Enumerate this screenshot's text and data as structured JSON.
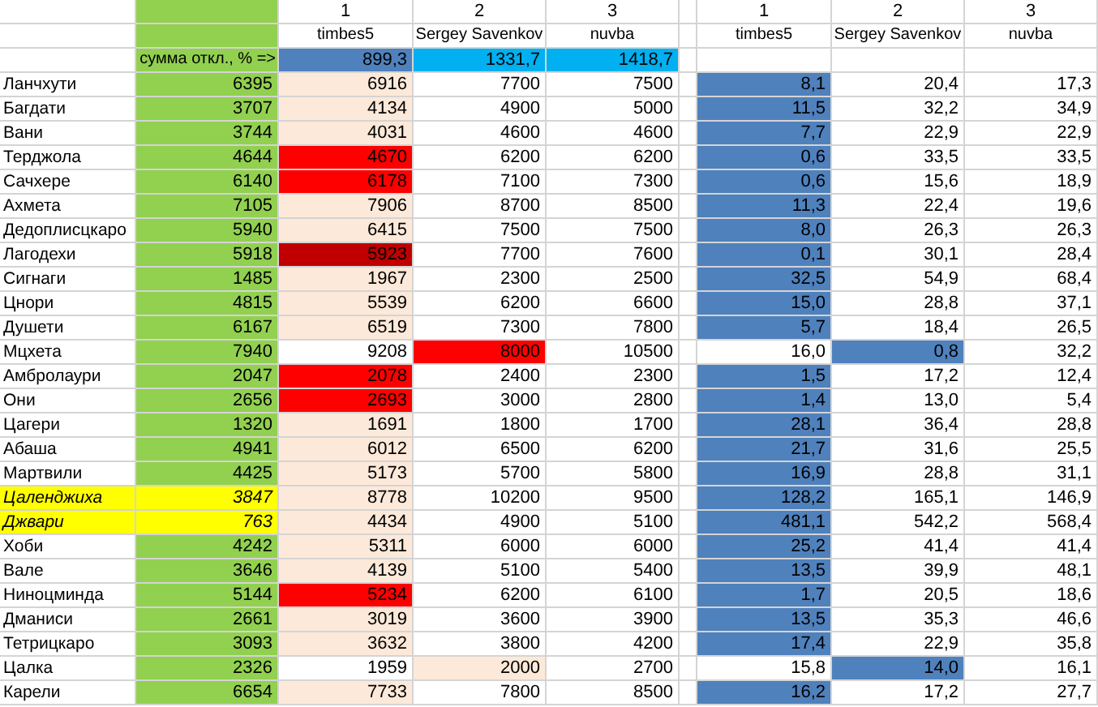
{
  "column_numbers": [
    "1",
    "2",
    "3"
  ],
  "participants": [
    "timbes5",
    "Sergey Savenkov",
    "nuvba"
  ],
  "totals_label": "сумма откл., % =>",
  "totals": [
    {
      "value": "899,3",
      "best": true
    },
    {
      "value": "1331,7",
      "best": false
    },
    {
      "value": "1418,7",
      "best": false
    }
  ],
  "deviation_column_numbers": [
    "1",
    "2",
    "3"
  ],
  "deviation_participants": [
    "timbes5",
    "Sergey Savenkov",
    "nuvba"
  ],
  "rows": [
    {
      "name": "Ланчхути",
      "actual": "6395",
      "emphasized": false,
      "estimates": [
        {
          "value": "6916",
          "color": "#fde9d9"
        },
        {
          "value": "7700",
          "color": "#ffffff"
        },
        {
          "value": "7500",
          "color": "#ffffff"
        }
      ],
      "deviations": [
        {
          "value": "8,1",
          "best": true
        },
        {
          "value": "20,4",
          "best": false
        },
        {
          "value": "17,3",
          "best": false
        }
      ]
    },
    {
      "name": "Багдати",
      "actual": "3707",
      "emphasized": false,
      "estimates": [
        {
          "value": "4134",
          "color": "#fde9d9"
        },
        {
          "value": "4900",
          "color": "#ffffff"
        },
        {
          "value": "5000",
          "color": "#ffffff"
        }
      ],
      "deviations": [
        {
          "value": "11,5",
          "best": true
        },
        {
          "value": "32,2",
          "best": false
        },
        {
          "value": "34,9",
          "best": false
        }
      ]
    },
    {
      "name": "Вани",
      "actual": "3744",
      "emphasized": false,
      "estimates": [
        {
          "value": "4031",
          "color": "#fde9d9"
        },
        {
          "value": "4600",
          "color": "#ffffff"
        },
        {
          "value": "4600",
          "color": "#ffffff"
        }
      ],
      "deviations": [
        {
          "value": "7,7",
          "best": true
        },
        {
          "value": "22,9",
          "best": false
        },
        {
          "value": "22,9",
          "best": false
        }
      ]
    },
    {
      "name": "Терджола",
      "actual": "4644",
      "emphasized": false,
      "estimates": [
        {
          "value": "4670",
          "color": "#ff0000"
        },
        {
          "value": "6200",
          "color": "#ffffff"
        },
        {
          "value": "6200",
          "color": "#ffffff"
        }
      ],
      "deviations": [
        {
          "value": "0,6",
          "best": true
        },
        {
          "value": "33,5",
          "best": false
        },
        {
          "value": "33,5",
          "best": false
        }
      ]
    },
    {
      "name": "Сачхере",
      "actual": "6140",
      "emphasized": false,
      "estimates": [
        {
          "value": "6178",
          "color": "#ff0000"
        },
        {
          "value": "7100",
          "color": "#ffffff"
        },
        {
          "value": "7300",
          "color": "#ffffff"
        }
      ],
      "deviations": [
        {
          "value": "0,6",
          "best": true
        },
        {
          "value": "15,6",
          "best": false
        },
        {
          "value": "18,9",
          "best": false
        }
      ]
    },
    {
      "name": "Ахмета",
      "actual": "7105",
      "emphasized": false,
      "estimates": [
        {
          "value": "7906",
          "color": "#fde9d9"
        },
        {
          "value": "8700",
          "color": "#ffffff"
        },
        {
          "value": "8500",
          "color": "#ffffff"
        }
      ],
      "deviations": [
        {
          "value": "11,3",
          "best": true
        },
        {
          "value": "22,4",
          "best": false
        },
        {
          "value": "19,6",
          "best": false
        }
      ]
    },
    {
      "name": "Дедоплисцкаро",
      "actual": "5940",
      "emphasized": false,
      "estimates": [
        {
          "value": "6415",
          "color": "#fde9d9"
        },
        {
          "value": "7500",
          "color": "#ffffff"
        },
        {
          "value": "7500",
          "color": "#ffffff"
        }
      ],
      "deviations": [
        {
          "value": "8,0",
          "best": true
        },
        {
          "value": "26,3",
          "best": false
        },
        {
          "value": "26,3",
          "best": false
        }
      ]
    },
    {
      "name": "Лагодехи",
      "actual": "5918",
      "emphasized": false,
      "estimates": [
        {
          "value": "5923",
          "color": "#c00000"
        },
        {
          "value": "7700",
          "color": "#ffffff"
        },
        {
          "value": "7600",
          "color": "#ffffff"
        }
      ],
      "deviations": [
        {
          "value": "0,1",
          "best": true
        },
        {
          "value": "30,1",
          "best": false
        },
        {
          "value": "28,4",
          "best": false
        }
      ]
    },
    {
      "name": "Сигнаги",
      "actual": "1485",
      "emphasized": false,
      "estimates": [
        {
          "value": "1967",
          "color": "#fde9d9"
        },
        {
          "value": "2300",
          "color": "#ffffff"
        },
        {
          "value": "2500",
          "color": "#ffffff"
        }
      ],
      "deviations": [
        {
          "value": "32,5",
          "best": true
        },
        {
          "value": "54,9",
          "best": false
        },
        {
          "value": "68,4",
          "best": false
        }
      ]
    },
    {
      "name": "Цнори",
      "actual": "4815",
      "emphasized": false,
      "estimates": [
        {
          "value": "5539",
          "color": "#fde9d9"
        },
        {
          "value": "6200",
          "color": "#ffffff"
        },
        {
          "value": "6600",
          "color": "#ffffff"
        }
      ],
      "deviations": [
        {
          "value": "15,0",
          "best": true
        },
        {
          "value": "28,8",
          "best": false
        },
        {
          "value": "37,1",
          "best": false
        }
      ]
    },
    {
      "name": "Душети",
      "actual": "6167",
      "emphasized": false,
      "estimates": [
        {
          "value": "6519",
          "color": "#fde9d9"
        },
        {
          "value": "7300",
          "color": "#ffffff"
        },
        {
          "value": "7800",
          "color": "#ffffff"
        }
      ],
      "deviations": [
        {
          "value": "5,7",
          "best": true
        },
        {
          "value": "18,4",
          "best": false
        },
        {
          "value": "26,5",
          "best": false
        }
      ]
    },
    {
      "name": "Мцхета",
      "actual": "7940",
      "emphasized": false,
      "estimates": [
        {
          "value": "9208",
          "color": "#ffffff"
        },
        {
          "value": "8000",
          "color": "#ff0000"
        },
        {
          "value": "10500",
          "color": "#ffffff"
        }
      ],
      "deviations": [
        {
          "value": "16,0",
          "best": false
        },
        {
          "value": "0,8",
          "best": true
        },
        {
          "value": "32,2",
          "best": false
        }
      ]
    },
    {
      "name": "Амбролаури",
      "actual": "2047",
      "emphasized": false,
      "estimates": [
        {
          "value": "2078",
          "color": "#ff0000"
        },
        {
          "value": "2400",
          "color": "#ffffff"
        },
        {
          "value": "2300",
          "color": "#ffffff"
        }
      ],
      "deviations": [
        {
          "value": "1,5",
          "best": true
        },
        {
          "value": "17,2",
          "best": false
        },
        {
          "value": "12,4",
          "best": false
        }
      ]
    },
    {
      "name": "Они",
      "actual": "2656",
      "emphasized": false,
      "estimates": [
        {
          "value": "2693",
          "color": "#ff0000"
        },
        {
          "value": "3000",
          "color": "#ffffff"
        },
        {
          "value": "2800",
          "color": "#ffffff"
        }
      ],
      "deviations": [
        {
          "value": "1,4",
          "best": true
        },
        {
          "value": "13,0",
          "best": false
        },
        {
          "value": "5,4",
          "best": false
        }
      ]
    },
    {
      "name": "Цагери",
      "actual": "1320",
      "emphasized": false,
      "estimates": [
        {
          "value": "1691",
          "color": "#fde9d9"
        },
        {
          "value": "1800",
          "color": "#ffffff"
        },
        {
          "value": "1700",
          "color": "#ffffff"
        }
      ],
      "deviations": [
        {
          "value": "28,1",
          "best": true
        },
        {
          "value": "36,4",
          "best": false
        },
        {
          "value": "28,8",
          "best": false
        }
      ]
    },
    {
      "name": "Абаша",
      "actual": "4941",
      "emphasized": false,
      "estimates": [
        {
          "value": "6012",
          "color": "#fde9d9"
        },
        {
          "value": "6500",
          "color": "#ffffff"
        },
        {
          "value": "6200",
          "color": "#ffffff"
        }
      ],
      "deviations": [
        {
          "value": "21,7",
          "best": true
        },
        {
          "value": "31,6",
          "best": false
        },
        {
          "value": "25,5",
          "best": false
        }
      ]
    },
    {
      "name": "Мартвили",
      "actual": "4425",
      "emphasized": false,
      "estimates": [
        {
          "value": "5173",
          "color": "#fde9d9"
        },
        {
          "value": "5700",
          "color": "#ffffff"
        },
        {
          "value": "5800",
          "color": "#ffffff"
        }
      ],
      "deviations": [
        {
          "value": "16,9",
          "best": true
        },
        {
          "value": "28,8",
          "best": false
        },
        {
          "value": "31,1",
          "best": false
        }
      ]
    },
    {
      "name": "Цаленджиха",
      "actual": "3847",
      "emphasized": true,
      "estimates": [
        {
          "value": "8778",
          "color": "#fde9d9"
        },
        {
          "value": "10200",
          "color": "#ffffff"
        },
        {
          "value": "9500",
          "color": "#ffffff"
        }
      ],
      "deviations": [
        {
          "value": "128,2",
          "best": true
        },
        {
          "value": "165,1",
          "best": false
        },
        {
          "value": "146,9",
          "best": false
        }
      ]
    },
    {
      "name": "Джвари",
      "actual": "763",
      "emphasized": true,
      "estimates": [
        {
          "value": "4434",
          "color": "#fde9d9"
        },
        {
          "value": "4900",
          "color": "#ffffff"
        },
        {
          "value": "5100",
          "color": "#ffffff"
        }
      ],
      "deviations": [
        {
          "value": "481,1",
          "best": true
        },
        {
          "value": "542,2",
          "best": false
        },
        {
          "value": "568,4",
          "best": false
        }
      ]
    },
    {
      "name": "Хоби",
      "actual": "4242",
      "emphasized": false,
      "estimates": [
        {
          "value": "5311",
          "color": "#fde9d9"
        },
        {
          "value": "6000",
          "color": "#ffffff"
        },
        {
          "value": "6000",
          "color": "#ffffff"
        }
      ],
      "deviations": [
        {
          "value": "25,2",
          "best": true
        },
        {
          "value": "41,4",
          "best": false
        },
        {
          "value": "41,4",
          "best": false
        }
      ]
    },
    {
      "name": "Вале",
      "actual": "3646",
      "emphasized": false,
      "estimates": [
        {
          "value": "4139",
          "color": "#fde9d9"
        },
        {
          "value": "5100",
          "color": "#ffffff"
        },
        {
          "value": "5400",
          "color": "#ffffff"
        }
      ],
      "deviations": [
        {
          "value": "13,5",
          "best": true
        },
        {
          "value": "39,9",
          "best": false
        },
        {
          "value": "48,1",
          "best": false
        }
      ]
    },
    {
      "name": "Ниноцминда",
      "actual": "5144",
      "emphasized": false,
      "estimates": [
        {
          "value": "5234",
          "color": "#ff0000"
        },
        {
          "value": "6200",
          "color": "#ffffff"
        },
        {
          "value": "6100",
          "color": "#ffffff"
        }
      ],
      "deviations": [
        {
          "value": "1,7",
          "best": true
        },
        {
          "value": "20,5",
          "best": false
        },
        {
          "value": "18,6",
          "best": false
        }
      ]
    },
    {
      "name": "Дманиси",
      "actual": "2661",
      "emphasized": false,
      "estimates": [
        {
          "value": "3019",
          "color": "#fde9d9"
        },
        {
          "value": "3600",
          "color": "#ffffff"
        },
        {
          "value": "3900",
          "color": "#ffffff"
        }
      ],
      "deviations": [
        {
          "value": "13,5",
          "best": true
        },
        {
          "value": "35,3",
          "best": false
        },
        {
          "value": "46,6",
          "best": false
        }
      ]
    },
    {
      "name": "Тетрицкаро",
      "actual": "3093",
      "emphasized": false,
      "estimates": [
        {
          "value": "3632",
          "color": "#fde9d9"
        },
        {
          "value": "3800",
          "color": "#ffffff"
        },
        {
          "value": "4200",
          "color": "#ffffff"
        }
      ],
      "deviations": [
        {
          "value": "17,4",
          "best": true
        },
        {
          "value": "22,9",
          "best": false
        },
        {
          "value": "35,8",
          "best": false
        }
      ]
    },
    {
      "name": "Цалка",
      "actual": "2326",
      "emphasized": false,
      "estimates": [
        {
          "value": "1959",
          "color": "#ffffff"
        },
        {
          "value": "2000",
          "color": "#fde9d9"
        },
        {
          "value": "2700",
          "color": "#ffffff"
        }
      ],
      "deviations": [
        {
          "value": "15,8",
          "best": false
        },
        {
          "value": "14,0",
          "best": true
        },
        {
          "value": "16,1",
          "best": false
        }
      ]
    },
    {
      "name": "Карели",
      "actual": "6654",
      "emphasized": false,
      "estimates": [
        {
          "value": "7733",
          "color": "#fde9d9"
        },
        {
          "value": "7800",
          "color": "#ffffff"
        },
        {
          "value": "8500",
          "color": "#ffffff"
        }
      ],
      "deviations": [
        {
          "value": "16,2",
          "best": true
        },
        {
          "value": "17,2",
          "best": false
        },
        {
          "value": "27,7",
          "best": false
        }
      ]
    }
  ]
}
